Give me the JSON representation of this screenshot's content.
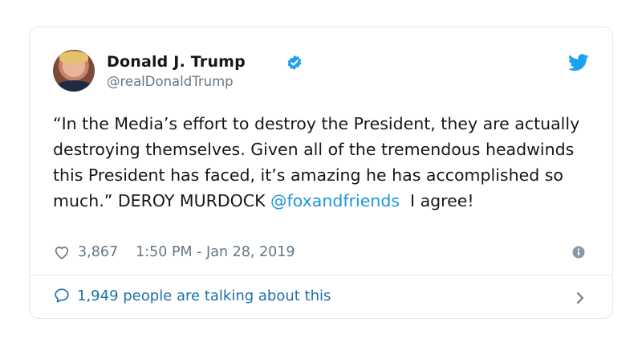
{
  "tweet": {
    "author_name": "Donald J. Trump",
    "author_handle": "@realDonaldTrump",
    "text_part1": "“In the Media’s effort to destroy the President, they are actually destroying themselves. Given all of the tremendous headwinds this President has faced, it’s amazing he has accomplished so much.” DEROY MURDOCK ",
    "mention": "@foxandfriends",
    "text_part2": "  I agree!",
    "like_count": "3,867",
    "timestamp": "1:50 PM - Jan 28, 2019",
    "talking_text": "1,949 people are talking about this"
  },
  "icons": {
    "verified": "verified-badge-icon",
    "brand": "twitter-bird-icon",
    "like": "heart-icon",
    "info": "info-icon",
    "reply": "speech-bubble-icon",
    "chevron": "chevron-right-icon"
  },
  "colors": {
    "brand_blue": "#1da1f2",
    "link_blue": "#1b95e0",
    "muted": "#657786",
    "border": "#e1e8ed"
  }
}
